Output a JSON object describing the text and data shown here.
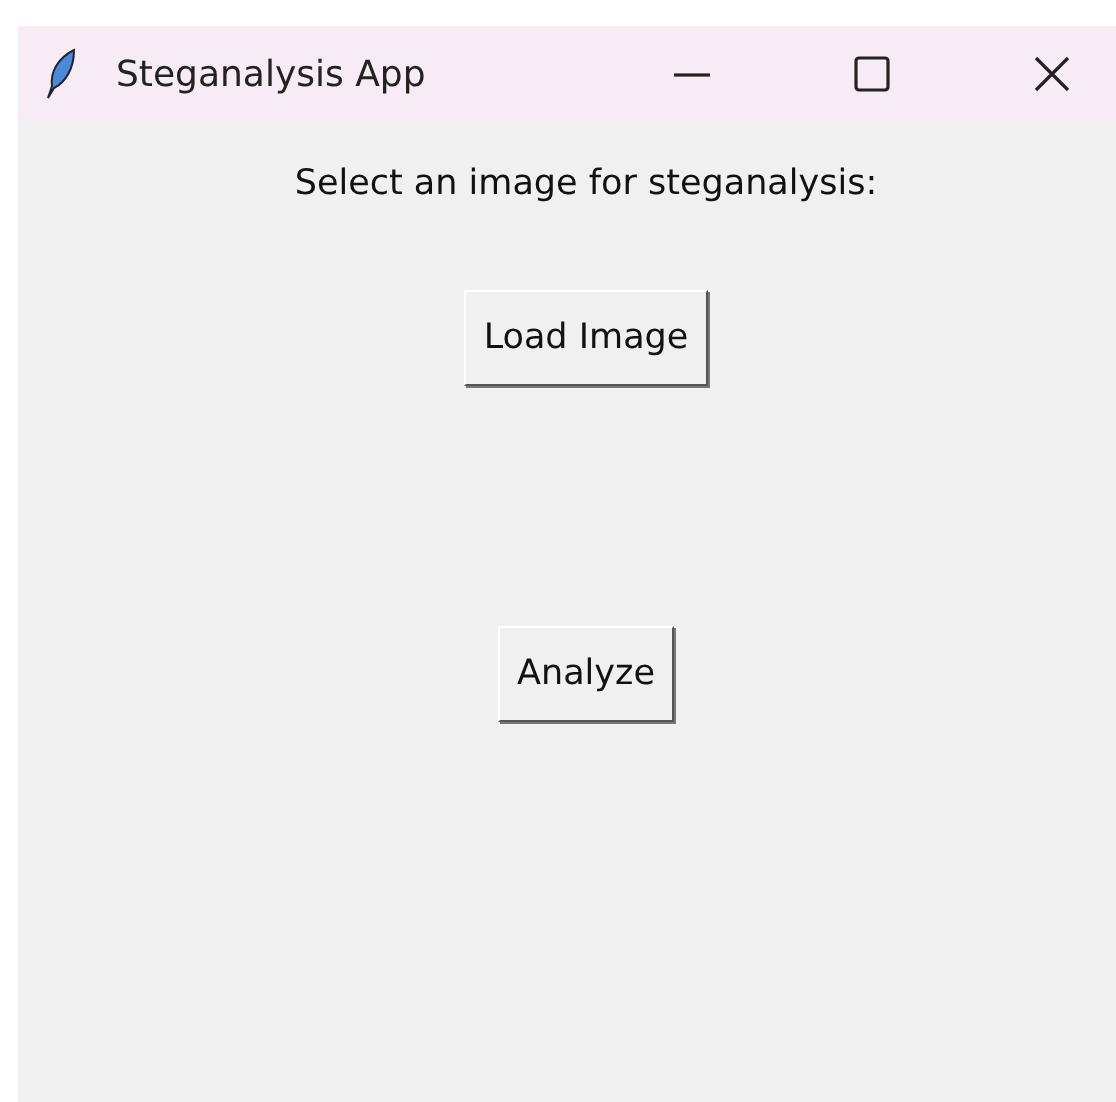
{
  "window": {
    "title": "Steganalysis App"
  },
  "prompt": "Select an image for steganalysis:",
  "buttons": [
    {
      "label": "Load Image"
    },
    {
      "label": "Analyze"
    }
  ]
}
